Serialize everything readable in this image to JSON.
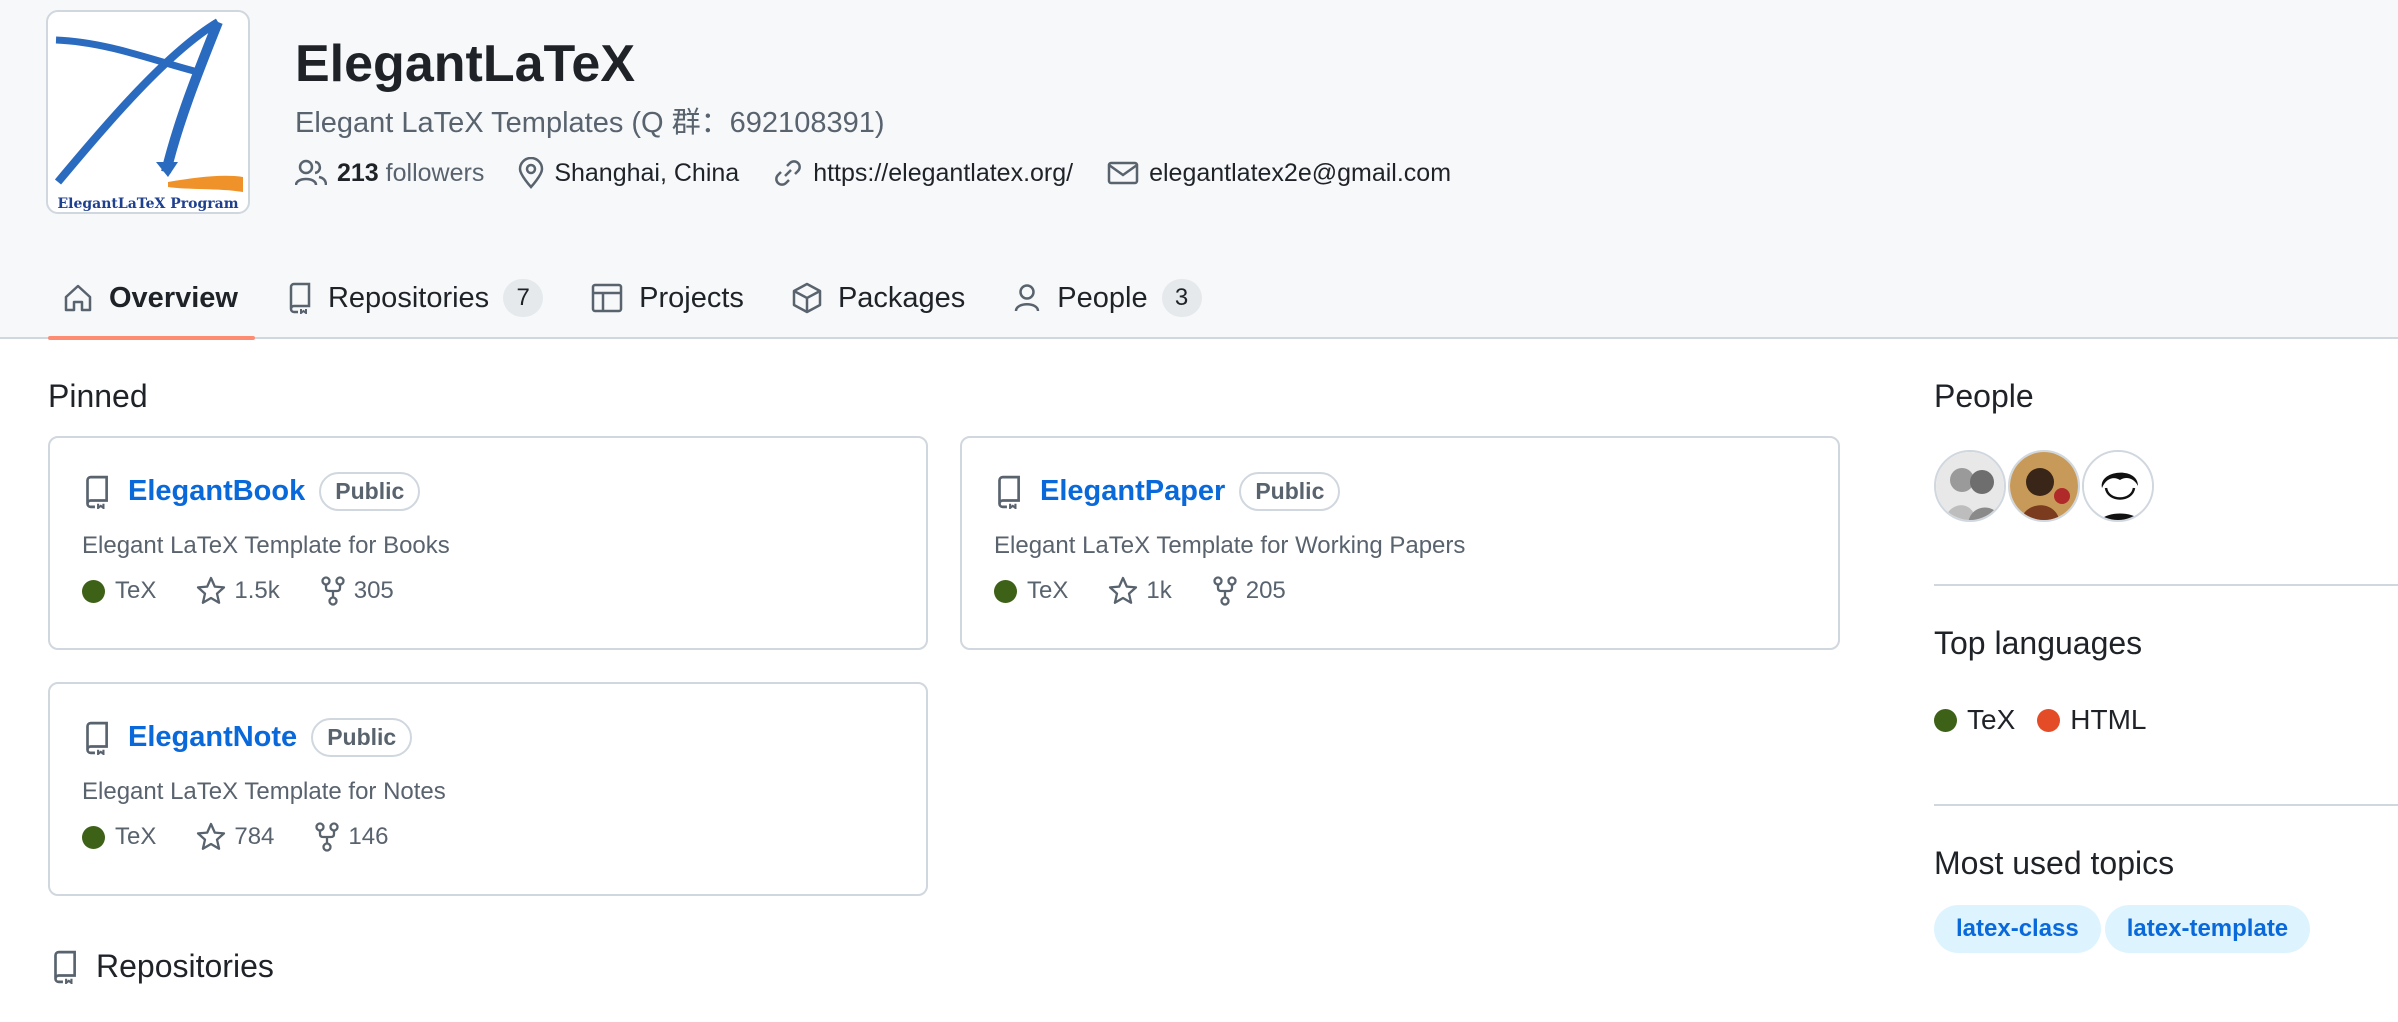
{
  "org": {
    "name": "ElegantLaTeX",
    "description": "Elegant LaTeX Templates (Q 群：692108391)",
    "logo_text": "ElegantLaTeX Program",
    "followers_count": "213",
    "followers_label": "followers",
    "location": "Shanghai, China",
    "website": "https://elegantlatex.org/",
    "email": "elegantlatex2e@gmail.com"
  },
  "tabs": [
    {
      "label": "Overview",
      "icon": "home-icon",
      "active": true
    },
    {
      "label": "Repositories",
      "icon": "repo-icon",
      "count": "7"
    },
    {
      "label": "Projects",
      "icon": "table-icon"
    },
    {
      "label": "Packages",
      "icon": "package-icon"
    },
    {
      "label": "People",
      "icon": "person-icon",
      "count": "3"
    }
  ],
  "pinned": {
    "title": "Pinned",
    "repos": [
      {
        "name": "ElegantBook",
        "visibility": "Public",
        "description": "Elegant LaTeX Template for Books",
        "language": "TeX",
        "stars": "1.5k",
        "forks": "305"
      },
      {
        "name": "ElegantPaper",
        "visibility": "Public",
        "description": "Elegant LaTeX Template for Working Papers",
        "language": "TeX",
        "stars": "1k",
        "forks": "205"
      },
      {
        "name": "ElegantNote",
        "visibility": "Public",
        "description": "Elegant LaTeX Template for Notes",
        "language": "TeX",
        "stars": "784",
        "forks": "146"
      }
    ]
  },
  "sidebar": {
    "people_title": "People",
    "languages_title": "Top languages",
    "languages": [
      {
        "name": "TeX",
        "color": "#3d6117"
      },
      {
        "name": "HTML",
        "color": "#e34c26"
      }
    ],
    "topics_title": "Most used topics",
    "topics": [
      "latex-class",
      "latex-template"
    ]
  },
  "repositories_title": "Repositories",
  "colors": {
    "tex": "#3d6117",
    "html": "#e34c26",
    "link": "#0969da",
    "tab_underline": "#fd8c73"
  }
}
